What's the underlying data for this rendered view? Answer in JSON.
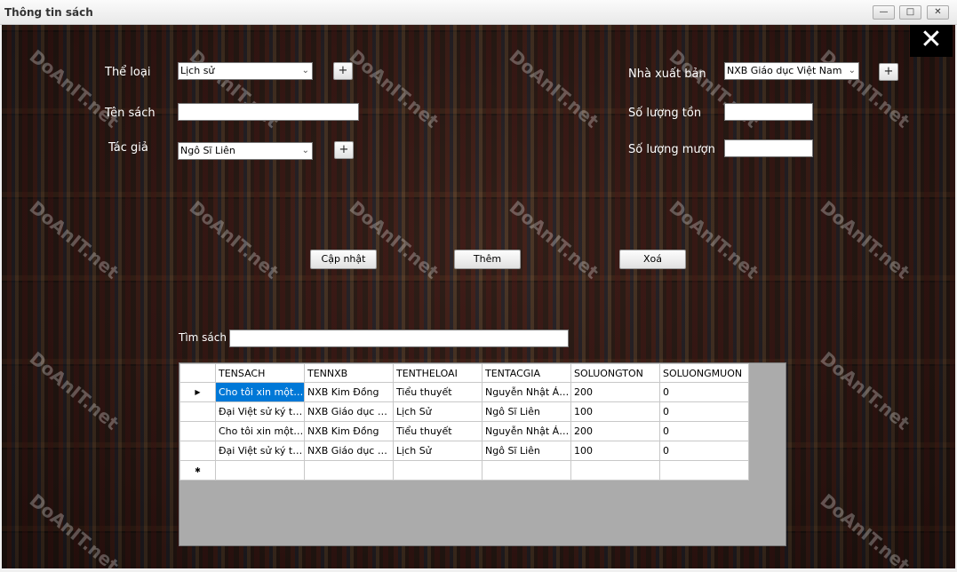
{
  "window": {
    "title": "Thông tin sách",
    "minimize": "—",
    "maximize": "□",
    "close": "✕"
  },
  "form": {
    "close_glyph": "✕",
    "the_loai_label": "Thể loại",
    "the_loai_value": "Lịch sử",
    "ten_sach_label": "Tên sách",
    "tac_gia_label": "Tác giả",
    "tac_gia_value": "Ngô Sĩ Liên",
    "nxb_label": "Nhà xuất bản",
    "nxb_value": "NXB Giáo dục Việt Nam",
    "so_luong_ton_label": "Số lượng tồn",
    "so_luong_muon_label": "Số lượng mượn",
    "plus": "+",
    "dropdown_arrow": "⌄",
    "cap_nhat_button": "Cập nhật",
    "them_button": "Thêm",
    "xoa_button": "Xoá",
    "tim_sach_label": "Tìm sách"
  },
  "grid": {
    "columns": [
      "TENSACH",
      "TENNXB",
      "TENTHELOAI",
      "TENTACGIA",
      "SOLUONGTON",
      "SOLUONGMUON"
    ],
    "current_row_marker": "▶",
    "new_row_marker": "✱",
    "rows": [
      [
        "Cho tôi xin một ...",
        "NXB Kim Đồng",
        "Tiểu thuyết",
        "Nguyễn Nhật Ánh",
        "200",
        "0"
      ],
      [
        "Đại Việt sử ký to...",
        "NXB Giáo dục Việ...",
        "Lịch Sử",
        "Ngô Sĩ Liên",
        "100",
        "0"
      ],
      [
        "Cho tôi xin một ...",
        "NXB Kim Đồng",
        "Tiểu thuyết",
        "Nguyễn Nhật Ánh",
        "200",
        "0"
      ],
      [
        "Đại Việt sử ký to...",
        "NXB Giáo dục Việ...",
        "Lịch Sử",
        "Ngô Sĩ Liên",
        "100",
        "0"
      ]
    ]
  },
  "watermark": "DoAnIT.net"
}
